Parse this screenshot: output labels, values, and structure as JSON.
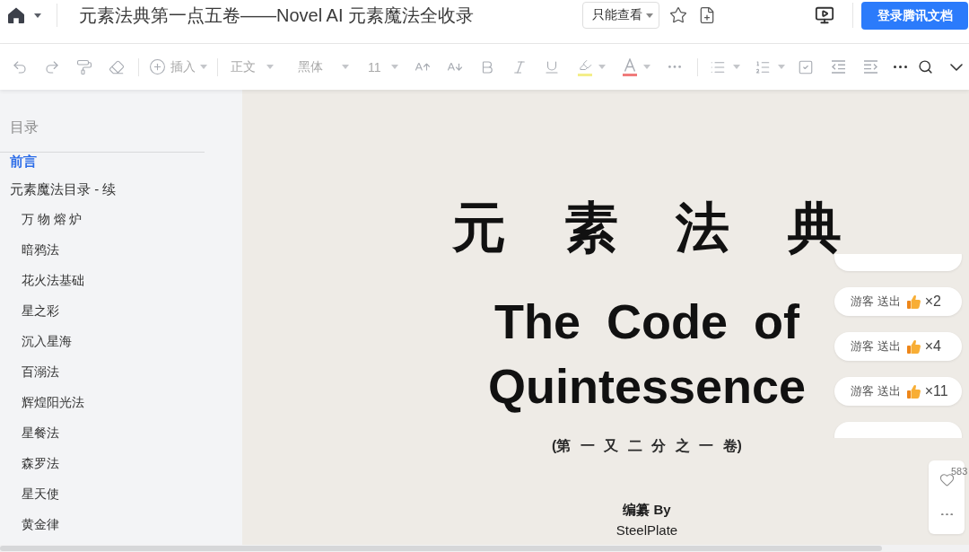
{
  "header": {
    "title": "元素法典第一点五卷——Novel AI 元素魔法全收录",
    "permission": "只能查看",
    "login_button": "登录腾讯文档"
  },
  "toolbar": {
    "disabled": true,
    "insert": "插入",
    "paragraph_style": "正文",
    "font": "黑体",
    "font_size": "11"
  },
  "sidebar": {
    "heading": "目录",
    "items": [
      {
        "label": "前言",
        "selected": true
      },
      {
        "label": "元素魔法目录 - 续",
        "selected": false,
        "children": [
          {
            "label": "万 物 熔 炉",
            "selected": false
          },
          {
            "label": "暗鸦法",
            "selected": false
          },
          {
            "label": "花火法基础",
            "selected": false
          },
          {
            "label": "星之彩",
            "selected": false
          },
          {
            "label": "沉入星海",
            "selected": false
          },
          {
            "label": "百溺法",
            "selected": false
          },
          {
            "label": "辉煌阳光法",
            "selected": false
          },
          {
            "label": "星餐法",
            "selected": false
          },
          {
            "label": "森罗法",
            "selected": false
          },
          {
            "label": "星天使",
            "selected": false
          },
          {
            "label": "黄金律",
            "selected": false
          }
        ]
      }
    ]
  },
  "document": {
    "title": "元 素 法 典",
    "subtitle_lines": [
      "The Code of",
      "Quintessence"
    ],
    "volume": "(第 一 又 二 分 之 一 卷)",
    "compiled_by": "编纂 By",
    "author": "SteelPlate"
  },
  "gift_toasts": [
    {
      "kind": "partial"
    },
    {
      "kind": "full",
      "text": "游客 送出",
      "count": "×2"
    },
    {
      "kind": "full",
      "text": "游客 送出",
      "count": "×4"
    },
    {
      "kind": "full",
      "text": "游客 送出",
      "count": "×11"
    },
    {
      "kind": "partial"
    }
  ],
  "likes": {
    "count": "583"
  }
}
